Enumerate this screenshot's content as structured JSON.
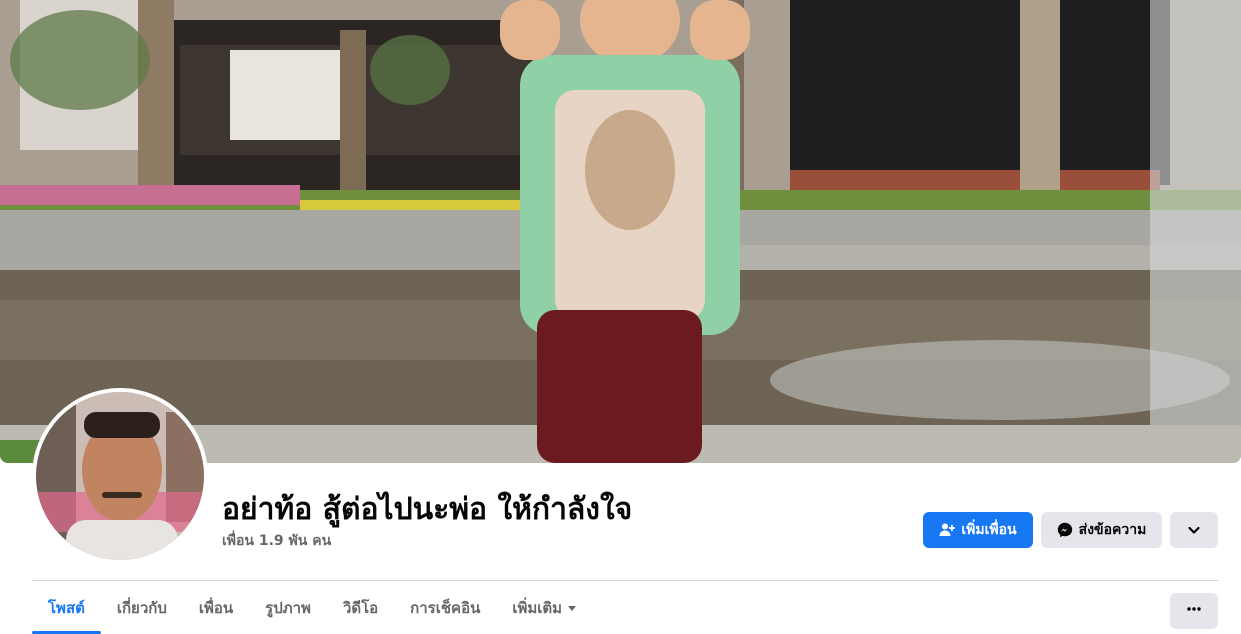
{
  "profile": {
    "name": "อย่าท้อ สู้ต่อไปนะพ่อ ให้กำลังใจ",
    "friends_count": "เพื่อน 1.9 พัน คน"
  },
  "actions": {
    "add_friend_label": "เพิ่มเพื่อน",
    "message_label": "ส่งข้อความ",
    "more_icon": "chevron-down-icon"
  },
  "tabs": [
    {
      "label": "โพสต์",
      "active": true
    },
    {
      "label": "เกี่ยวกับ",
      "active": false
    },
    {
      "label": "เพื่อน",
      "active": false
    },
    {
      "label": "รูปภาพ",
      "active": false
    },
    {
      "label": "วิดีโอ",
      "active": false
    },
    {
      "label": "การเช็คอิน",
      "active": false
    },
    {
      "label": "เพิ่มเติม",
      "active": false
    }
  ],
  "tab_options_icon": "ellipsis-icon",
  "colors": {
    "accent": "#1877f2",
    "secondary_button": "#e4e6eb",
    "muted_text": "#65676b"
  }
}
